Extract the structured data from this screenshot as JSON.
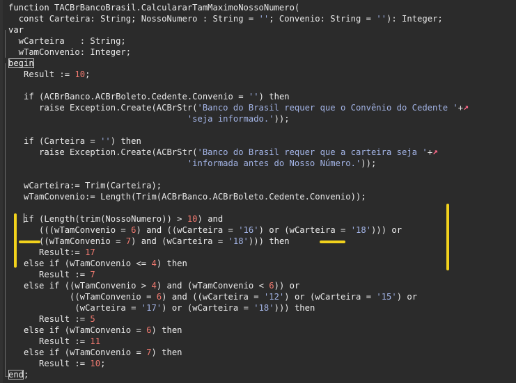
{
  "editor": {
    "lines": [
      [
        [
          "kw",
          "function"
        ],
        [
          "id",
          " TACBrBancoBrasil.CalculararTamMaximoNossoNumero("
        ]
      ],
      [
        [
          "id",
          "  "
        ],
        [
          "kw",
          "const"
        ],
        [
          "id",
          " Carteira: String; NossoNumero : String = "
        ],
        [
          "str",
          "''"
        ],
        [
          "id",
          "; Convenio: String = "
        ],
        [
          "str",
          "''"
        ],
        [
          "id",
          "): Integer;"
        ]
      ],
      [
        [
          "kw",
          "var"
        ]
      ],
      [
        [
          "id",
          "  wCarteira   : String;"
        ]
      ],
      [
        [
          "id",
          "  wTamConvenio: Integer;"
        ]
      ],
      [
        [
          "kw",
          "begin"
        ]
      ],
      [
        [
          "id",
          "   Result := "
        ],
        [
          "num",
          "10"
        ],
        [
          "id",
          ";"
        ]
      ],
      [],
      [
        [
          "id",
          "   "
        ],
        [
          "kw",
          "if"
        ],
        [
          "id",
          " (ACBrBanco.ACBrBoleto.Cedente.Convenio = "
        ],
        [
          "str",
          "''"
        ],
        [
          "id",
          ") "
        ],
        [
          "kw",
          "then"
        ]
      ],
      [
        [
          "id",
          "      "
        ],
        [
          "kw",
          "raise"
        ],
        [
          "id",
          " Exception.Create(ACBrStr("
        ],
        [
          "str",
          "'Banco do Brasil requer que o Convênio do Cedente '"
        ],
        [
          "id",
          "+"
        ],
        [
          "wrap",
          "↗"
        ]
      ],
      [
        [
          "id",
          "                                   "
        ],
        [
          "str",
          "'seja informado.'"
        ],
        [
          "id",
          "));"
        ]
      ],
      [],
      [
        [
          "id",
          "   "
        ],
        [
          "kw",
          "if"
        ],
        [
          "id",
          " (Carteira = "
        ],
        [
          "str",
          "''"
        ],
        [
          "id",
          ") "
        ],
        [
          "kw",
          "then"
        ]
      ],
      [
        [
          "id",
          "      "
        ],
        [
          "kw",
          "raise"
        ],
        [
          "id",
          " Exception.Create(ACBrStr("
        ],
        [
          "str",
          "'Banco do Brasil requer que a carteira seja '"
        ],
        [
          "id",
          "+"
        ],
        [
          "wrap",
          "↗"
        ]
      ],
      [
        [
          "id",
          "                                   "
        ],
        [
          "str",
          "'informada antes do Nosso Número.'"
        ],
        [
          "id",
          "));"
        ]
      ],
      [],
      [
        [
          "id",
          "   wCarteira:= Trim(Carteira);"
        ]
      ],
      [
        [
          "id",
          "   wTamConvenio:= Length(Trim(ACBrBanco.ACBrBoleto.Cedente.Convenio));"
        ]
      ],
      [],
      [
        [
          "id",
          "   "
        ],
        [
          "caret",
          ""
        ],
        [
          "kw",
          "if"
        ],
        [
          "id",
          " (Length(trim(NossoNumero)) > "
        ],
        [
          "num",
          "10"
        ],
        [
          "id",
          ") "
        ],
        [
          "kw",
          "and"
        ]
      ],
      [
        [
          "id",
          "      (((wTamConvenio = "
        ],
        [
          "num",
          "6"
        ],
        [
          "id",
          ") "
        ],
        [
          "kw",
          "and"
        ],
        [
          "id",
          " ((wCarteira = "
        ],
        [
          "str",
          "'16'"
        ],
        [
          "id",
          ") "
        ],
        [
          "kw",
          "or"
        ],
        [
          "id",
          " (wCarteira = "
        ],
        [
          "str",
          "'18'"
        ],
        [
          "id",
          "))) "
        ],
        [
          "kw",
          "or"
        ]
      ],
      [
        [
          "id",
          "      ((wTamConvenio = "
        ],
        [
          "num",
          "7"
        ],
        [
          "id",
          ") "
        ],
        [
          "kw",
          "and"
        ],
        [
          "id",
          " (wCarteira = "
        ],
        [
          "str",
          "'18'"
        ],
        [
          "id",
          "))) "
        ],
        [
          "kw",
          "then"
        ]
      ],
      [
        [
          "id",
          "      Result:= "
        ],
        [
          "num",
          "17"
        ]
      ],
      [
        [
          "id",
          "   "
        ],
        [
          "kw",
          "else if"
        ],
        [
          "id",
          " (wTamConvenio <= "
        ],
        [
          "num",
          "4"
        ],
        [
          "id",
          ") "
        ],
        [
          "kw",
          "then"
        ]
      ],
      [
        [
          "id",
          "      Result := "
        ],
        [
          "num",
          "7"
        ]
      ],
      [
        [
          "id",
          "   "
        ],
        [
          "kw",
          "else if"
        ],
        [
          "id",
          " ((wTamConvenio > "
        ],
        [
          "num",
          "4"
        ],
        [
          "id",
          ") "
        ],
        [
          "kw",
          "and"
        ],
        [
          "id",
          " (wTamConvenio < "
        ],
        [
          "num",
          "6"
        ],
        [
          "id",
          ")) "
        ],
        [
          "kw",
          "or"
        ]
      ],
      [
        [
          "id",
          "            ((wTamConvenio = "
        ],
        [
          "num",
          "6"
        ],
        [
          "id",
          ") "
        ],
        [
          "kw",
          "and"
        ],
        [
          "id",
          " ((wCarteira = "
        ],
        [
          "str",
          "'12'"
        ],
        [
          "id",
          ") "
        ],
        [
          "kw",
          "or"
        ],
        [
          "id",
          " (wCarteira = "
        ],
        [
          "str",
          "'15'"
        ],
        [
          "id",
          ") "
        ],
        [
          "kw",
          "or"
        ]
      ],
      [
        [
          "id",
          "             (wCarteira = "
        ],
        [
          "str",
          "'17'"
        ],
        [
          "id",
          ") "
        ],
        [
          "kw",
          "or"
        ],
        [
          "id",
          " (wCarteira = "
        ],
        [
          "str",
          "'18'"
        ],
        [
          "id",
          "))) "
        ],
        [
          "kw",
          "then"
        ]
      ],
      [
        [
          "id",
          "      Result := "
        ],
        [
          "num",
          "5"
        ]
      ],
      [
        [
          "id",
          "   "
        ],
        [
          "kw",
          "else if"
        ],
        [
          "id",
          " (wTamConvenio = "
        ],
        [
          "num",
          "6"
        ],
        [
          "id",
          ") "
        ],
        [
          "kw",
          "then"
        ]
      ],
      [
        [
          "id",
          "      Result := "
        ],
        [
          "num",
          "11"
        ]
      ],
      [
        [
          "id",
          "   "
        ],
        [
          "kw",
          "else if"
        ],
        [
          "id",
          " (wTamConvenio = "
        ],
        [
          "num",
          "7"
        ],
        [
          "id",
          ") "
        ],
        [
          "kw",
          "then"
        ]
      ],
      [
        [
          "id",
          "      Result := "
        ],
        [
          "num",
          "10"
        ],
        [
          "id",
          ";"
        ]
      ],
      [
        [
          "kw",
          "end"
        ],
        [
          "id",
          ";"
        ]
      ]
    ]
  },
  "colors": {
    "background": "#2b2b2b",
    "keyword": "#f0f0f0",
    "identifier": "#e8e8e8",
    "string": "#a3b4e6",
    "number": "#f07a70",
    "highlight_marker": "#f2d21c"
  }
}
